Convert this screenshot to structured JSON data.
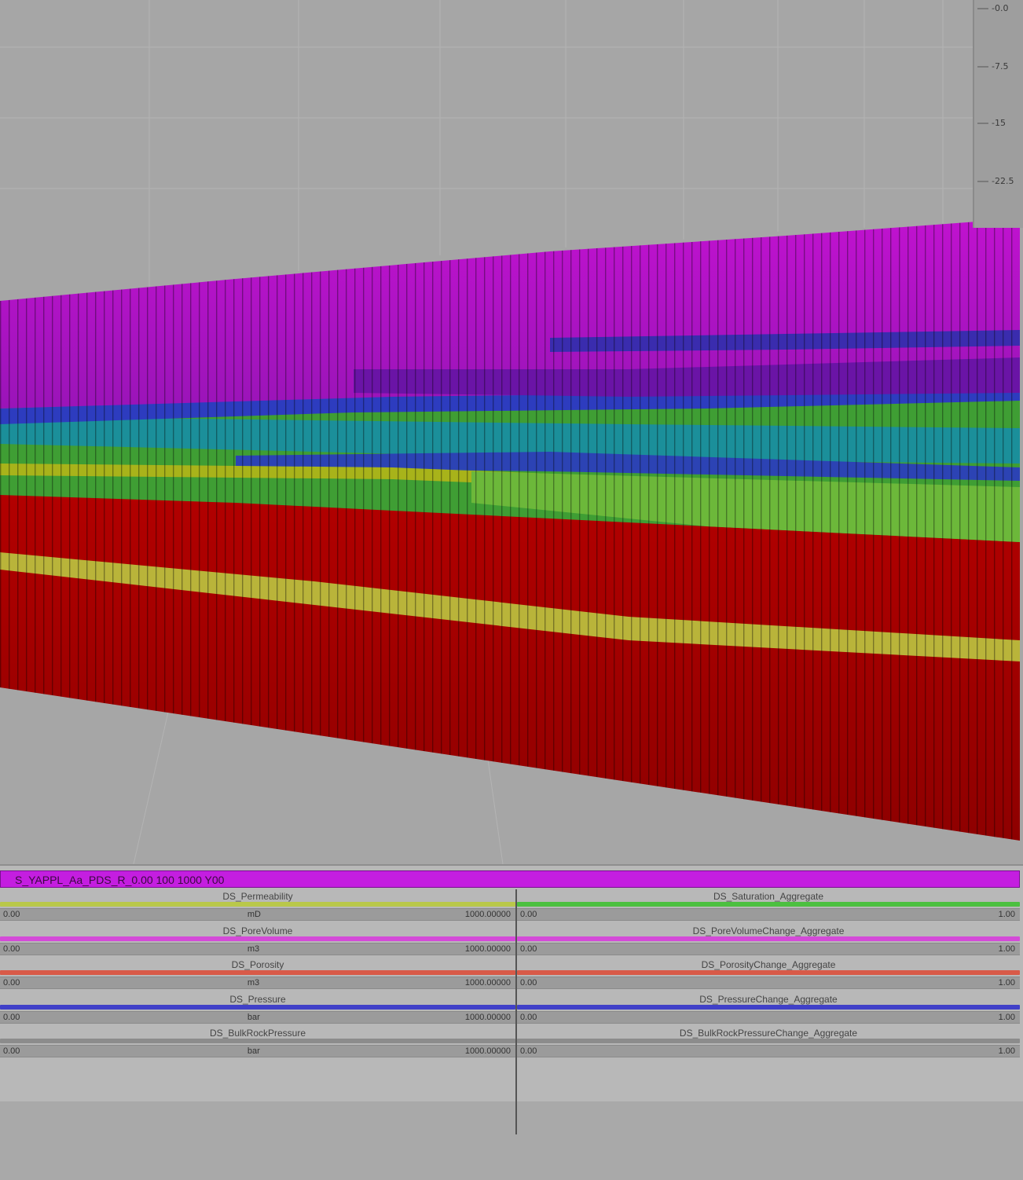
{
  "window": {
    "background": "#a6a6a6"
  },
  "scale_bar": {
    "labels": [
      "-0.0",
      "-7.5",
      "-15",
      "-22.5"
    ]
  },
  "model_colors": {
    "top_fill": "#b10fc2",
    "upper_purple": "#8a16b8",
    "green": "#5fae2a",
    "cyan": "#1fa8a0",
    "blue": "#2a3cc8",
    "yellow": "#b7b21a",
    "red": "#b00000",
    "dark_red": "#8f0000"
  },
  "panel": {
    "header": "S_YAPPL_Aa_PDS_R_0.00 100 1000 Y00",
    "header_color": "#c41ee0",
    "left_rows": [
      {
        "name": "DS_Permeability",
        "color": "#b9c84a",
        "min": "0.00",
        "unit": "mD",
        "max": "1000.00000"
      },
      {
        "name": "DS_PoreVolume",
        "color": "#d44ad8",
        "min": "0.00",
        "unit": "m3",
        "max": "1000.00000"
      },
      {
        "name": "DS_Porosity",
        "color": "#d85a48",
        "min": "0.00",
        "unit": "m3",
        "max": "1000.00000"
      },
      {
        "name": "DS_Pressure",
        "color": "#4040c8",
        "min": "0.00",
        "unit": "bar",
        "max": "1000.00000"
      },
      {
        "name": "DS_BulkRockPressure",
        "color": "#8c8c8c",
        "min": "0.00",
        "unit": "bar",
        "max": "1000.00000"
      }
    ],
    "right_rows": [
      {
        "name": "DS_Saturation_Aggregate",
        "color": "#4cc040",
        "min": "0.00",
        "max": "1.00"
      },
      {
        "name": "DS_PoreVolumeChange_Aggregate",
        "color": "#d44ad8",
        "min": "0.00",
        "max": "1.00"
      },
      {
        "name": "DS_PorosityChange_Aggregate",
        "color": "#d85a48",
        "min": "0.00",
        "max": "1.00"
      },
      {
        "name": "DS_PressureChange_Aggregate",
        "color": "#4040c8",
        "min": "0.00",
        "max": "1.00"
      },
      {
        "name": "DS_BulkRockPressureChange_Aggregate",
        "color": "#8c8c8c",
        "min": "0.00",
        "max": "1.00"
      }
    ]
  }
}
